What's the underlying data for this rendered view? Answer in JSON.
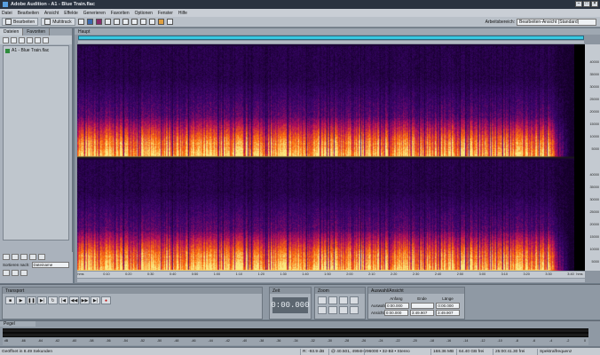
{
  "window": {
    "title": "Adobe Audition - A1 - Blue Train.flac"
  },
  "menu": [
    "Datei",
    "Bearbeiten",
    "Ansicht",
    "Effekte",
    "Generieren",
    "Favoriten",
    "Optionen",
    "Fenster",
    "Hilfe"
  ],
  "toolbar": {
    "edit_label": "Bearbeiten",
    "multitrack_label": "Multitrack",
    "workspace_label": "Arbeitsbereich:",
    "workspace_value": "Bearbeiten-Ansicht (Standard)"
  },
  "left_panel": {
    "tabs": [
      "Dateien",
      "Favoriten"
    ],
    "files": [
      "A1 - Blue Train.flac"
    ],
    "sort_label": "Sortieren nach:",
    "sort_value": "Dateiname"
  },
  "editor": {
    "tab": "Haupt"
  },
  "spectrum": {
    "freq_labels_top": [
      "40000",
      "35000",
      "30000",
      "25000",
      "20000",
      "15000",
      "10000",
      "5000"
    ],
    "freq_labels_bottom": [
      "40000",
      "35000",
      "30000",
      "25000",
      "20000",
      "15000",
      "10000",
      "5000"
    ],
    "time_labels": [
      "hms",
      "0:10",
      "0:20",
      "0:30",
      "0:40",
      "0:50",
      "1:00",
      "1:10",
      "1:20",
      "1:30",
      "1:40",
      "1:50",
      "2:00",
      "2:10",
      "2:20",
      "2:30",
      "2:40",
      "2:50",
      "3:00",
      "3:10",
      "3:20",
      "3:30",
      "3:40",
      "hms"
    ]
  },
  "transport": {
    "title": "Transport"
  },
  "time": {
    "title": "Zeit",
    "value": "0:00.000"
  },
  "zoom": {
    "title": "Zoom"
  },
  "selection": {
    "title": "Auswahl/Ansicht",
    "headers": [
      "Anfang",
      "Ende",
      "Länge"
    ],
    "rows": [
      {
        "label": "Auswahl",
        "start": "0:00.000",
        "end": "",
        "length": "0:00.000"
      },
      {
        "label": "Ansicht",
        "start": "0:00.000",
        "end": "3:49.907",
        "length": "3:49.907"
      }
    ]
  },
  "level": {
    "title": "Pegel",
    "scale": [
      "dB",
      "-66",
      "-64",
      "-62",
      "-60",
      "-58",
      "-56",
      "-54",
      "-52",
      "-50",
      "-48",
      "-46",
      "-44",
      "-42",
      "-40",
      "-38",
      "-36",
      "-34",
      "-32",
      "-30",
      "-28",
      "-26",
      "-24",
      "-22",
      "-20",
      "-18",
      "-16",
      "-14",
      "-12",
      "-10",
      "-8",
      "-6",
      "-4",
      "-2",
      "0"
    ]
  },
  "status": {
    "message": "Geöffnet in 8.49 Sekunden",
    "level": "R: -93.9 dB",
    "pos": "@ 40.501, 4994Hz",
    "format": "96000 • 32-Bit • Stereo",
    "size": "168.36 MB",
    "free": "64.40 GB frei",
    "time_free": "25:00:41.30 frei",
    "view": "Spektralfrequenz"
  }
}
